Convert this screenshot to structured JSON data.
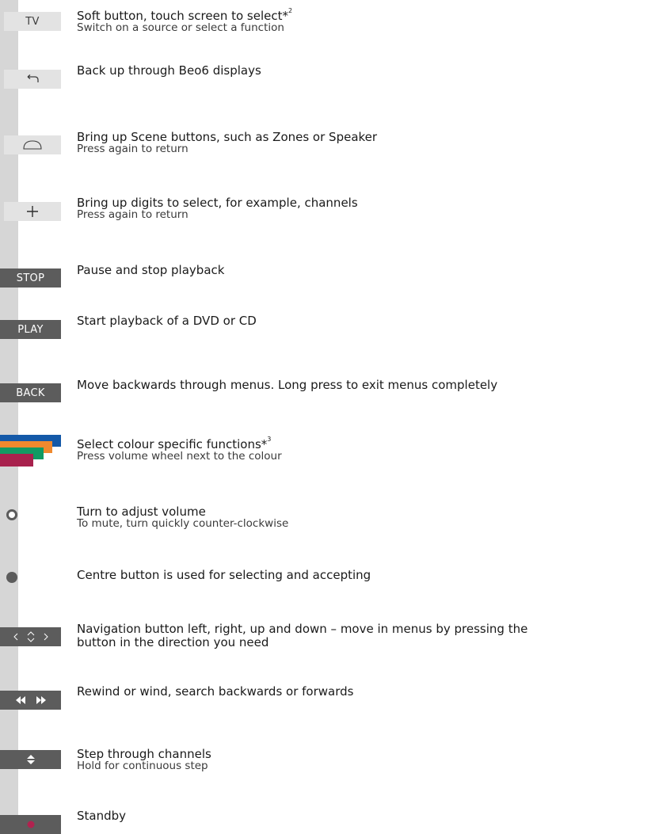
{
  "colors": {
    "strip": "#d6d6d6",
    "button_light": "#e3e3e3",
    "button_dark": "#5c5c5c",
    "blue": "#1459a8",
    "orange": "#f0892e",
    "green": "#119a63",
    "red": "#a8214d",
    "standby_dot": "#b0224f"
  },
  "rows": [
    {
      "button_label": "TV",
      "primary": "Soft button, touch screen to select*",
      "primary_sup": "2",
      "secondary": "Switch on a source or select a function"
    },
    {
      "button_icon": "back-arrow-icon",
      "primary": "Back up through Beo6 displays"
    },
    {
      "button_icon": "scene-dome-icon",
      "primary": "Bring up Scene buttons, such as Zones or Speaker",
      "secondary": "Press again to return"
    },
    {
      "button_icon": "plus-icon",
      "primary": "Bring up digits to select, for example, channels",
      "secondary": "Press again to return"
    },
    {
      "button_label": "STOP",
      "primary": "Pause and stop playback"
    },
    {
      "button_label": "PLAY",
      "primary": "Start playback of a DVD or CD"
    },
    {
      "button_label": "BACK",
      "primary": "Move backwards through menus. Long press to exit menus completely"
    },
    {
      "button_icon": "colour-buttons-icon",
      "primary": "Select colour specific functions*",
      "primary_sup": "3",
      "secondary": "Press volume wheel next to the colour"
    },
    {
      "button_icon": "volume-wheel-icon",
      "primary": "Turn to adjust volume",
      "secondary": "To mute, turn quickly counter-clockwise"
    },
    {
      "button_icon": "centre-button-icon",
      "primary": "Centre button is used for selecting and accepting"
    },
    {
      "button_icon": "navigation-arrows-icon",
      "primary": "Navigation button left, right, up and down – move in menus by pressing the",
      "primary_line2": "button in the direction you need"
    },
    {
      "button_icon": "rewind-wind-icon",
      "primary": "Rewind or wind, search backwards or forwards"
    },
    {
      "button_icon": "step-up-down-icon",
      "primary": "Step through channels",
      "secondary": "Hold for continuous step"
    },
    {
      "button_icon": "standby-icon",
      "primary": "Standby"
    }
  ]
}
